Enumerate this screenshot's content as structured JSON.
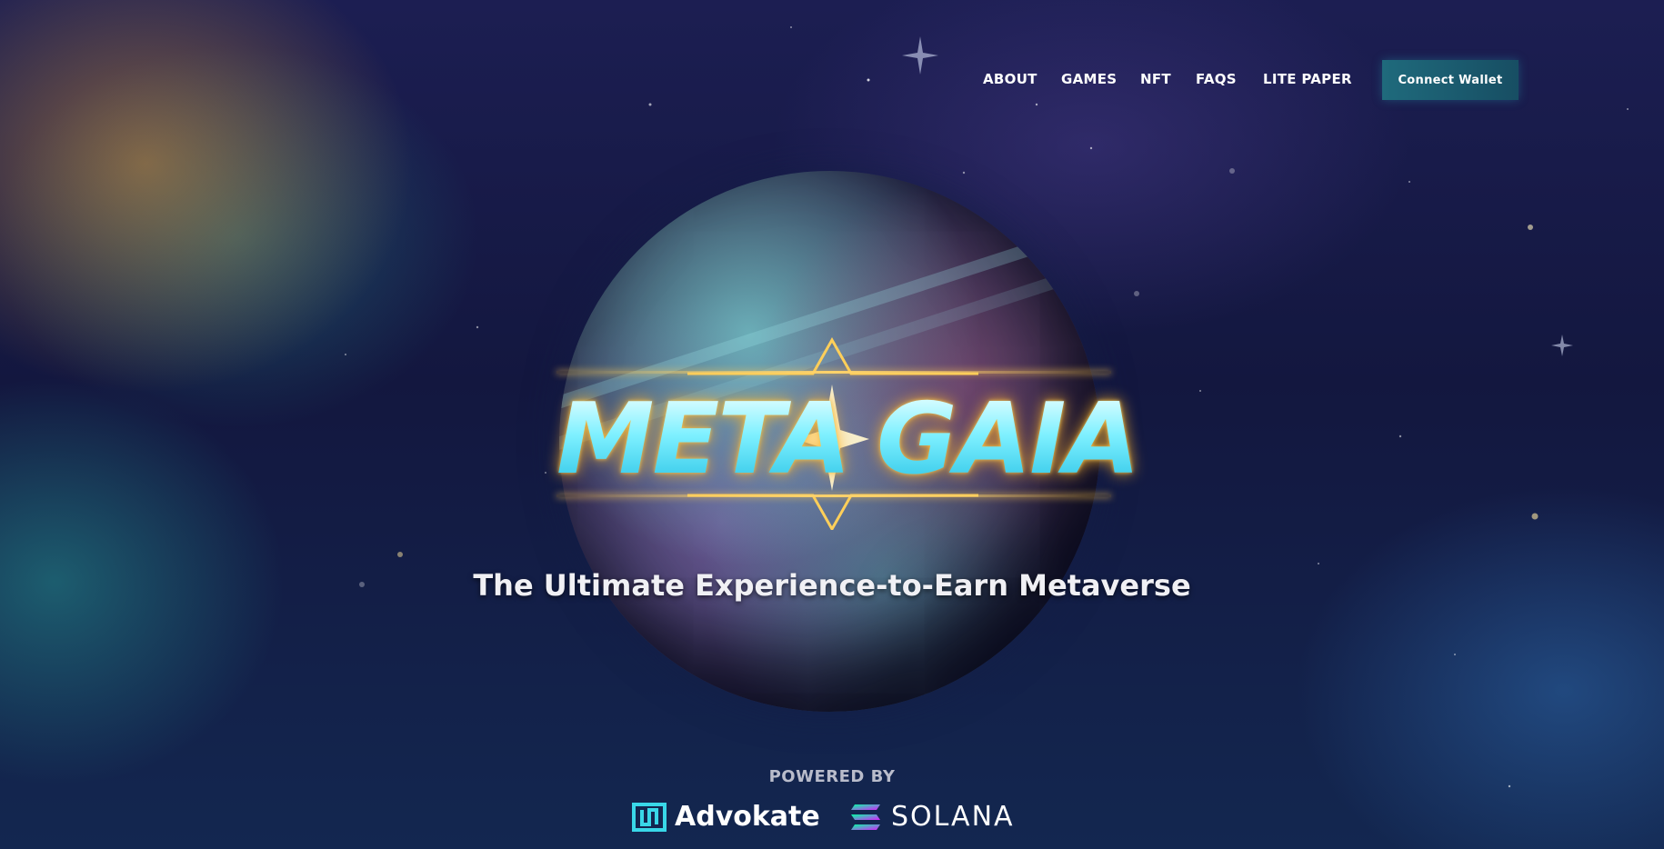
{
  "nav": {
    "items": [
      {
        "label": "ABOUT"
      },
      {
        "label": "GAMES"
      },
      {
        "label": "NFT"
      },
      {
        "label": "FAQS"
      },
      {
        "label": "LITE PAPER"
      }
    ],
    "connect_wallet_label": "Connect Wallet"
  },
  "hero": {
    "logo_text": "META GAIA",
    "logo_left": "META",
    "logo_right": "GAIA",
    "tagline": "The Ultimate Experience-to-Earn Metaverse"
  },
  "powered_by": {
    "label": "POWERED BY",
    "partners": [
      {
        "name": "Advokate",
        "icon": "advokate-logo-icon"
      },
      {
        "name": "SOLANA",
        "icon": "solana-logo-icon"
      }
    ]
  },
  "colors": {
    "accent": "#1f6a7c",
    "logo_cyan": "#7ef0ff",
    "logo_gold": "#ffd36a",
    "text": "#ffffff"
  }
}
